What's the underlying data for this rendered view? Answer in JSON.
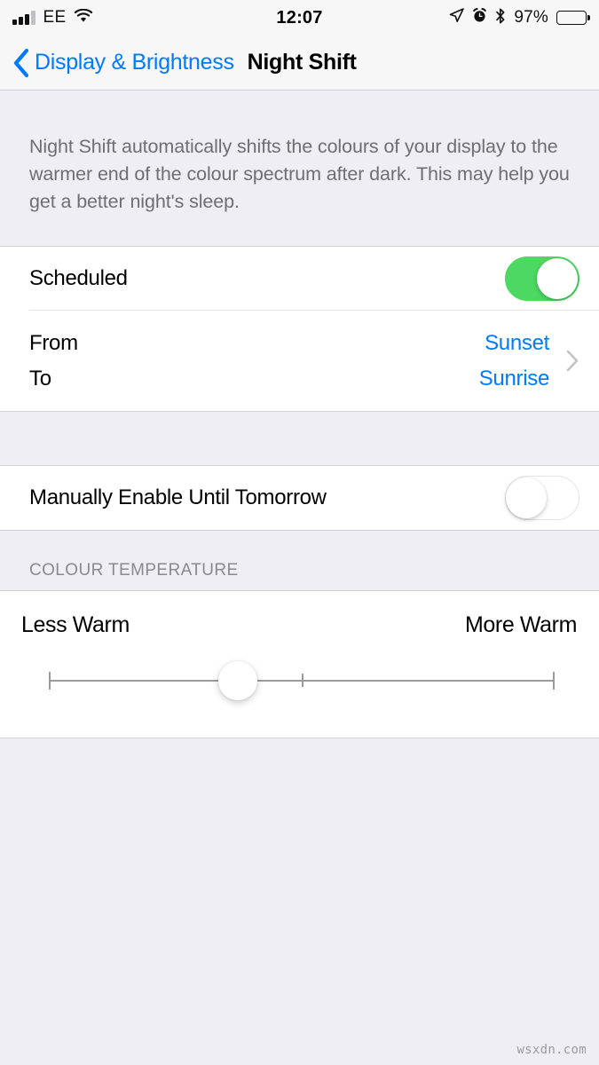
{
  "status_bar": {
    "carrier": "EE",
    "signal_bars_filled": 3,
    "signal_bars_total": 4,
    "wifi_icon": "wifi-icon",
    "time": "12:07",
    "location_icon": "location-arrow-icon",
    "alarm_icon": "alarm-clock-icon",
    "bluetooth_icon": "bluetooth-icon",
    "battery_percent": "97%",
    "battery_level": 97
  },
  "nav": {
    "back_icon": "chevron-left-icon",
    "back_label": "Display & Brightness",
    "title": "Night Shift"
  },
  "description": "Night Shift automatically shifts the colours of your display to the warmer end of the colour spectrum after dark. This may help you get a better night's sleep.",
  "schedule_group": {
    "scheduled": {
      "label": "Scheduled",
      "toggle_state": "on"
    },
    "from_to": {
      "from_label": "From",
      "to_label": "To",
      "from_value": "Sunset",
      "to_value": "Sunrise",
      "disclosure_icon": "chevron-right-icon"
    }
  },
  "manual_group": {
    "manual_enable": {
      "label": "Manually Enable Until Tomorrow",
      "toggle_state": "off"
    }
  },
  "colour_temperature": {
    "header": "COLOUR TEMPERATURE",
    "min_label": "Less Warm",
    "max_label": "More Warm",
    "slider_value_percent": 37
  },
  "watermark": "wsxdn.com",
  "colors": {
    "accent_blue": "#007AFF",
    "toggle_on_green": "#4CD862",
    "background_gray": "#EFEEF3",
    "cell_white": "#FFFFFF",
    "secondary_text": "#6E6E73",
    "header_text": "#8A8A8E"
  }
}
